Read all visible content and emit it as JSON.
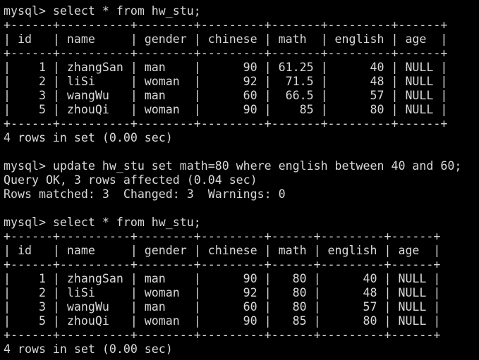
{
  "terminal": {
    "lines": [
      "mysql> select * from hw_stu;",
      "+------+----------+--------+---------+-------+---------+------+",
      "| id   | name     | gender | chinese | math  | english | age  |",
      "+------+----------+--------+---------+-------+---------+------+",
      "|    1 | zhangSan | man    |      90 | 61.25 |      40 | NULL |",
      "|    2 | liSi     | woman  |      92 |  71.5 |      48 | NULL |",
      "|    3 | wangWu   | man    |      60 |  66.5 |      57 | NULL |",
      "|    5 | zhouQi   | woman  |      90 |    85 |      80 | NULL |",
      "+------+----------+--------+---------+-------+---------+------+",
      "4 rows in set (0.00 sec)",
      "",
      "mysql> update hw_stu set math=80 where english between 40 and 60;",
      "Query OK, 3 rows affected (0.04 sec)",
      "Rows matched: 3  Changed: 3  Warnings: 0",
      "",
      "mysql> select * from hw_stu;",
      "+------+----------+--------+---------+------+---------+------+",
      "| id   | name     | gender | chinese | math | english | age  |",
      "+------+----------+--------+---------+------+---------+------+",
      "|    1 | zhangSan | man    |      90 |   80 |      40 | NULL |",
      "|    2 | liSi     | woman  |      92 |   80 |      48 | NULL |",
      "|    3 | wangWu   | man    |      60 |   80 |      57 | NULL |",
      "|    5 | zhouQi   | woman  |      90 |   85 |      80 | NULL |",
      "+------+----------+--------+---------+------+---------+------+",
      "4 rows in set (0.00 sec)"
    ]
  }
}
